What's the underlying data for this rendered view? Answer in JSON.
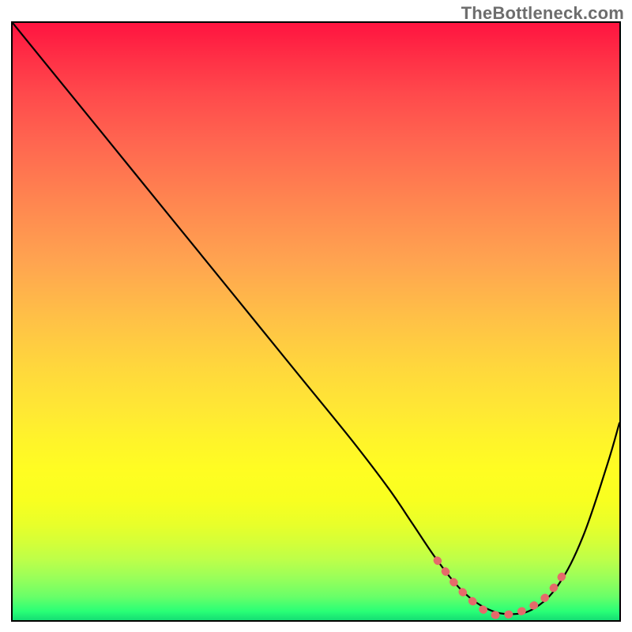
{
  "watermark": "TheBottleneck.com",
  "chart_data": {
    "type": "line",
    "title": "",
    "xlabel": "",
    "ylabel": "",
    "xlim": [
      0,
      100
    ],
    "ylim": [
      0,
      100
    ],
    "grid": false,
    "background": "rainbow-gradient-red-to-green",
    "series": [
      {
        "name": "bottleneck-curve",
        "color": "#000000",
        "x": [
          0,
          8,
          16,
          24,
          32,
          40,
          48,
          56,
          62,
          66,
          70,
          74,
          78,
          82,
          86,
          90,
          94,
          98,
          100
        ],
        "values": [
          100,
          90,
          80,
          70,
          60,
          50,
          40,
          30,
          22,
          16,
          10,
          5,
          2,
          1,
          2,
          6,
          14,
          26,
          33
        ]
      },
      {
        "name": "optimal-range-marker",
        "color": "#e56a6a",
        "x": [
          70,
          73,
          76,
          79,
          82,
          85,
          88,
          91
        ],
        "values": [
          10,
          6,
          3,
          1,
          1,
          2,
          4,
          8
        ]
      }
    ],
    "annotations": []
  }
}
